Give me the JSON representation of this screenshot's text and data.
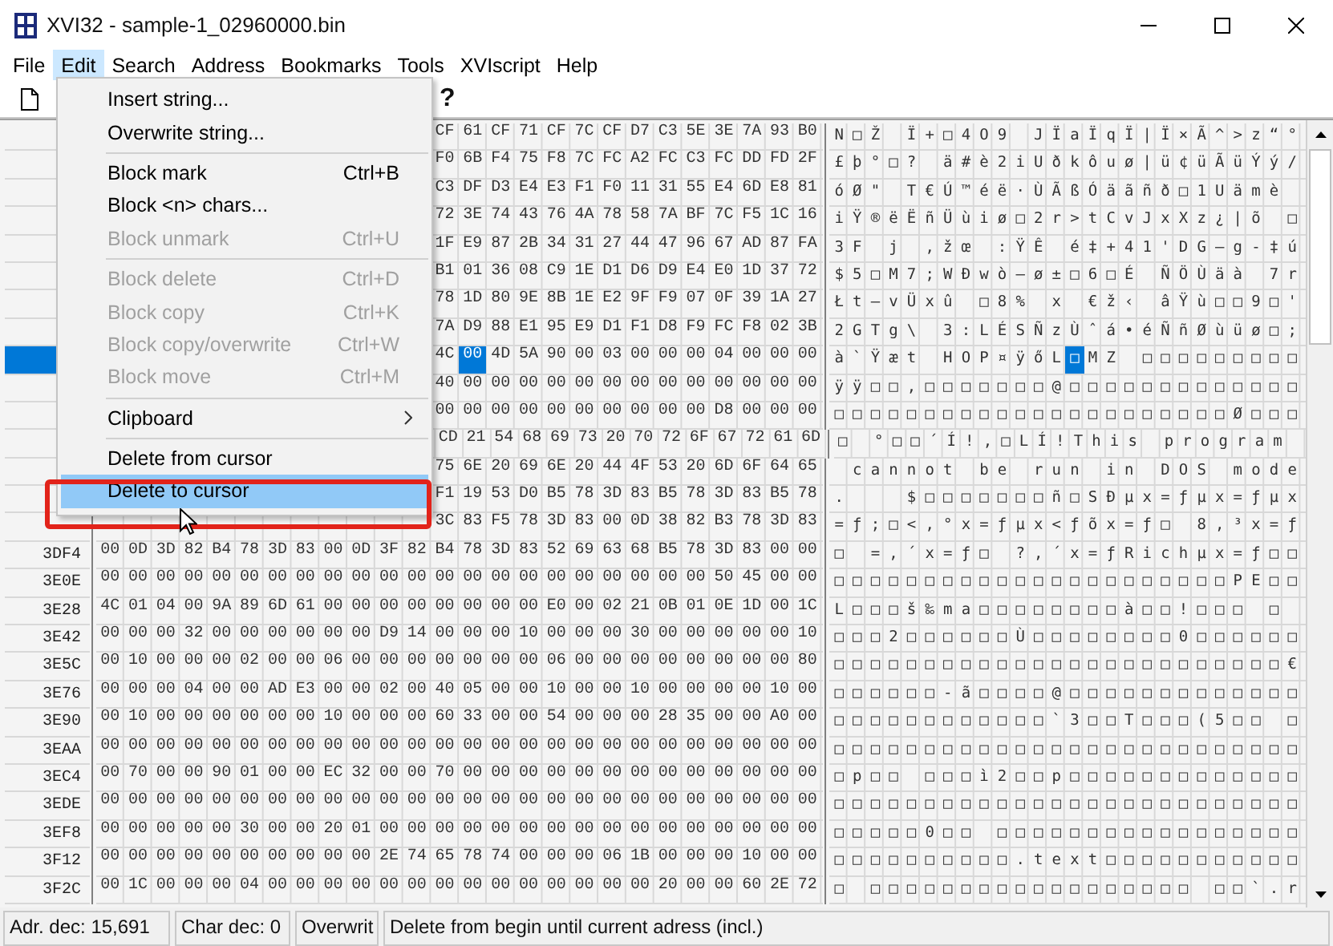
{
  "window": {
    "title": "XVI32 - sample-1_02960000.bin"
  },
  "menu_bar": [
    {
      "label": "File",
      "selected": false
    },
    {
      "label": "Edit",
      "selected": true
    },
    {
      "label": "Search",
      "selected": false
    },
    {
      "label": "Address",
      "selected": false
    },
    {
      "label": "Bookmarks",
      "selected": false
    },
    {
      "label": "Tools",
      "selected": false
    },
    {
      "label": "XVIscript",
      "selected": false
    },
    {
      "label": "Help",
      "selected": false
    }
  ],
  "toolbar": {
    "text": "?"
  },
  "edit_menu": {
    "items": [
      {
        "kind": "item",
        "label": "Insert string...",
        "disabled": false,
        "selected": false
      },
      {
        "kind": "item",
        "label": "Overwrite string...",
        "disabled": false,
        "selected": false
      },
      {
        "kind": "separator"
      },
      {
        "kind": "item",
        "label": "Block mark",
        "shortcut": "Ctrl+B",
        "disabled": false,
        "selected": false
      },
      {
        "kind": "item",
        "label": "Block <n> chars...",
        "disabled": false,
        "selected": false
      },
      {
        "kind": "item",
        "label": "Block unmark",
        "shortcut": "Ctrl+U",
        "disabled": true,
        "selected": false
      },
      {
        "kind": "separator"
      },
      {
        "kind": "item",
        "label": "Block delete",
        "shortcut": "Ctrl+D",
        "disabled": true,
        "selected": false
      },
      {
        "kind": "item",
        "label": "Block copy",
        "shortcut": "Ctrl+K",
        "disabled": true,
        "selected": false
      },
      {
        "kind": "item",
        "label": "Block copy/overwrite",
        "shortcut": "Ctrl+W",
        "disabled": true,
        "selected": false
      },
      {
        "kind": "item",
        "label": "Block move",
        "shortcut": "Ctrl+M",
        "disabled": true,
        "selected": false
      },
      {
        "kind": "separator"
      },
      {
        "kind": "submenu",
        "label": "Clipboard",
        "disabled": false,
        "selected": false
      },
      {
        "kind": "separator"
      },
      {
        "kind": "item",
        "label": "Delete from cursor",
        "disabled": false,
        "selected": false
      },
      {
        "kind": "item",
        "label": "Delete to cursor",
        "disabled": false,
        "selected": true
      }
    ]
  },
  "grid": {
    "rows": [
      {
        "selected": false,
        "hex": [
          "CF",
          "61",
          "CF",
          "71",
          "CF",
          "7C",
          "CF",
          "D7",
          "C3",
          "5E",
          "3E",
          "7A",
          "93",
          "B0"
        ],
        "chars": "N□Ž Ï+□4O9 JÏaÏqÏ|Ï×Ã^>z“°"
      },
      {
        "selected": false,
        "hex": [
          "F0",
          "6B",
          "F4",
          "75",
          "F8",
          "7C",
          "FC",
          "A2",
          "FC",
          "C3",
          "FC",
          "DD",
          "FD",
          "2F"
        ],
        "chars": "£þ°□? ä#è2iUðkôuø|ü¢üÃüÝý/"
      },
      {
        "selected": false,
        "hex": [
          "C3",
          "DF",
          "D3",
          "E4",
          "E3",
          "F1",
          "F0",
          "11",
          "31",
          "55",
          "E4",
          "6D",
          "E8",
          "81"
        ],
        "chars": "óØ\" T€Ú™éë·ÙÃßÓäãñð□1Uämè "
      },
      {
        "selected": false,
        "hex": [
          "72",
          "3E",
          "74",
          "43",
          "76",
          "4A",
          "78",
          "58",
          "7A",
          "BF",
          "7C",
          "F5",
          "1C",
          "16"
        ],
        "chars": "iŸ®ëËñÜùiø□2r>tCvJxXz¿|õ □"
      },
      {
        "selected": false,
        "hex": [
          "1F",
          "E9",
          "87",
          "2B",
          "34",
          "31",
          "27",
          "44",
          "47",
          "96",
          "67",
          "AD",
          "87",
          "FA"
        ],
        "chars": "3F j ,žœ :ŸÊ é‡+41'DG–g-‡ú"
      },
      {
        "selected": false,
        "hex": [
          "B1",
          "01",
          "36",
          "08",
          "C9",
          "1E",
          "D1",
          "D6",
          "D9",
          "E4",
          "E0",
          "1D",
          "37",
          "72"
        ],
        "chars": "$5□M7;WÐwò—ø±□6□É ÑÖÙäà 7r"
      },
      {
        "selected": false,
        "hex": [
          "78",
          "1D",
          "80",
          "9E",
          "8B",
          "1E",
          "E2",
          "9F",
          "F9",
          "07",
          "0F",
          "39",
          "1A",
          "27"
        ],
        "chars": "Łt–vÜxû □8% x €ž‹ âŸù□□9□'"
      },
      {
        "selected": false,
        "hex": [
          "7A",
          "D9",
          "88",
          "E1",
          "95",
          "E9",
          "D1",
          "F1",
          "D8",
          "F9",
          "FC",
          "F8",
          "02",
          "3B"
        ],
        "chars": "2GTg\\ 3:LÉSÑzÙˆá•éÑñØùüø□;"
      },
      {
        "selected": true,
        "hex": [
          "4C"
        ],
        "chars": "à`Ÿæt HOP¤ÿőL",
        "cursor": {
          "hex": "00",
          "char": "□",
          "hex_after": [
            "4D",
            "5A",
            "90",
            "00",
            "03",
            "00",
            "00",
            "00",
            "04",
            "00",
            "00",
            "00"
          ],
          "chars_after": "MZ □□□□□□□□□"
        }
      },
      {
        "selected": false,
        "hex": [
          "40",
          "00",
          "00",
          "00",
          "00",
          "00",
          "00",
          "00",
          "00",
          "00",
          "00",
          "00",
          "00",
          "00"
        ],
        "chars": "ÿÿ□□,□□□□□□□@□□□□□□□□□□□□□"
      },
      {
        "selected": false,
        "hex": [
          "00",
          "00",
          "00",
          "00",
          "00",
          "00",
          "00",
          "00",
          "00",
          "00",
          "D8",
          "00",
          "00",
          "00"
        ],
        "chars": "□□□□□□□□□□□□□□□□□□□□□□Ø□□□"
      },
      {
        "selected": false,
        "hex": [
          "CD",
          "21",
          "54",
          "68",
          "69",
          "73",
          "20",
          "70",
          "72",
          "6F",
          "67",
          "72",
          "61",
          "6D"
        ],
        "chars": "□ °□□´Í!,□LÍ!This program"
      },
      {
        "selected": false,
        "hex": [
          "75",
          "6E",
          "20",
          "69",
          "6E",
          "20",
          "44",
          "4F",
          "53",
          "20",
          "6D",
          "6F",
          "64",
          "65"
        ],
        "chars": " cannot be run in DOS mode"
      },
      {
        "selected": false,
        "hex": [
          "F1",
          "19",
          "53",
          "D0",
          "B5",
          "78",
          "3D",
          "83",
          "B5",
          "78",
          "3D",
          "83",
          "B5",
          "78"
        ],
        "chars": ".   $□□□□□□□ñ□SÐµx=ƒµx=ƒµx"
      },
      {
        "selected": false,
        "hex": [
          "3C",
          "83",
          "F5",
          "78",
          "3D",
          "83",
          "00",
          "0D",
          "38",
          "82",
          "B3",
          "78",
          "3D",
          "83"
        ],
        "chars": "=ƒ;□<,°x=ƒµx<ƒõx=ƒ□ 8‚³x=ƒ"
      },
      {
        "address": "3DF4",
        "selected": false,
        "hex": [
          "00",
          "0D",
          "3D",
          "82",
          "B4",
          "78",
          "3D",
          "83",
          "00",
          "0D",
          "3F",
          "82",
          "B4",
          "78",
          "3D",
          "83",
          "52",
          "69",
          "63",
          "68",
          "B5",
          "78",
          "3D",
          "83",
          "00",
          "00"
        ],
        "chars": "□ =‚´x=ƒ□ ?‚´x=ƒRichµx=ƒ□□"
      },
      {
        "address": "3E0E",
        "selected": false,
        "hex": [
          "00",
          "00",
          "00",
          "00",
          "00",
          "00",
          "00",
          "00",
          "00",
          "00",
          "00",
          "00",
          "00",
          "00",
          "00",
          "00",
          "00",
          "00",
          "00",
          "00",
          "00",
          "00",
          "50",
          "45",
          "00",
          "00"
        ],
        "chars": "□□□□□□□□□□□□□□□□□□□□□□PE□□"
      },
      {
        "address": "3E28",
        "selected": false,
        "hex": [
          "4C",
          "01",
          "04",
          "00",
          "9A",
          "89",
          "6D",
          "61",
          "00",
          "00",
          "00",
          "00",
          "00",
          "00",
          "00",
          "00",
          "E0",
          "00",
          "02",
          "21",
          "0B",
          "01",
          "0E",
          "1D",
          "00",
          "1C"
        ],
        "chars": "L□□□š‰ma□□□□□□□□à□□!□□□ □ "
      },
      {
        "address": "3E42",
        "selected": false,
        "hex": [
          "00",
          "00",
          "00",
          "32",
          "00",
          "00",
          "00",
          "00",
          "00",
          "00",
          "D9",
          "14",
          "00",
          "00",
          "00",
          "10",
          "00",
          "00",
          "00",
          "30",
          "00",
          "00",
          "00",
          "00",
          "00",
          "10"
        ],
        "chars": "□□□2□□□□□□Ù□□□□□□□□0□□□□□□"
      },
      {
        "address": "3E5C",
        "selected": false,
        "hex": [
          "00",
          "10",
          "00",
          "00",
          "00",
          "02",
          "00",
          "00",
          "06",
          "00",
          "00",
          "00",
          "00",
          "00",
          "00",
          "00",
          "06",
          "00",
          "00",
          "00",
          "00",
          "00",
          "00",
          "00",
          "00",
          "80"
        ],
        "chars": "□□□□□□□□□□□□□□□□□□□□□□□□□€"
      },
      {
        "address": "3E76",
        "selected": false,
        "hex": [
          "00",
          "00",
          "00",
          "04",
          "00",
          "00",
          "AD",
          "E3",
          "00",
          "00",
          "02",
          "00",
          "40",
          "05",
          "00",
          "00",
          "10",
          "00",
          "00",
          "10",
          "00",
          "00",
          "00",
          "00",
          "10",
          "00"
        ],
        "chars": "□□□□□□-ã□□□□@□□□□□□□□□□□□□"
      },
      {
        "address": "3E90",
        "selected": false,
        "hex": [
          "00",
          "10",
          "00",
          "00",
          "00",
          "00",
          "00",
          "00",
          "10",
          "00",
          "00",
          "00",
          "60",
          "33",
          "00",
          "00",
          "54",
          "00",
          "00",
          "00",
          "28",
          "35",
          "00",
          "00",
          "A0",
          "00"
        ],
        "chars": "□□□□□□□□□□□□`3□□T□□□(5□□ □"
      },
      {
        "address": "3EAA",
        "selected": false,
        "hex": [
          "00",
          "00",
          "00",
          "00",
          "00",
          "00",
          "00",
          "00",
          "00",
          "00",
          "00",
          "00",
          "00",
          "00",
          "00",
          "00",
          "00",
          "00",
          "00",
          "00",
          "00",
          "00",
          "00",
          "00",
          "00",
          "00"
        ],
        "chars": "□□□□□□□□□□□□□□□□□□□□□□□□□□"
      },
      {
        "address": "3EC4",
        "selected": false,
        "hex": [
          "00",
          "70",
          "00",
          "00",
          "90",
          "01",
          "00",
          "00",
          "EC",
          "32",
          "00",
          "00",
          "70",
          "00",
          "00",
          "00",
          "00",
          "00",
          "00",
          "00",
          "00",
          "00",
          "00",
          "00",
          "00",
          "00"
        ],
        "chars": "□p□□ □□□ì2□□p□□□□□□□□□□□□□"
      },
      {
        "address": "3EDE",
        "selected": false,
        "hex": [
          "00",
          "00",
          "00",
          "00",
          "00",
          "00",
          "00",
          "00",
          "00",
          "00",
          "00",
          "00",
          "00",
          "00",
          "00",
          "00",
          "00",
          "00",
          "00",
          "00",
          "00",
          "00",
          "00",
          "00",
          "00",
          "00"
        ],
        "chars": "□□□□□□□□□□□□□□□□□□□□□□□□□□"
      },
      {
        "address": "3EF8",
        "selected": false,
        "hex": [
          "00",
          "00",
          "00",
          "00",
          "00",
          "30",
          "00",
          "00",
          "20",
          "01",
          "00",
          "00",
          "00",
          "00",
          "00",
          "00",
          "00",
          "00",
          "00",
          "00",
          "00",
          "00",
          "00",
          "00",
          "00",
          "00"
        ],
        "chars": "□□□□□0□□ □□□□□□□□□□□□□□□□□"
      },
      {
        "address": "3F12",
        "selected": false,
        "hex": [
          "00",
          "00",
          "00",
          "00",
          "00",
          "00",
          "00",
          "00",
          "00",
          "00",
          "2E",
          "74",
          "65",
          "78",
          "74",
          "00",
          "00",
          "00",
          "06",
          "1B",
          "00",
          "00",
          "00",
          "10",
          "00",
          "00"
        ],
        "chars": "□□□□□□□□□□.text□□□□□□□□□□□"
      },
      {
        "address": "3F2C",
        "selected": false,
        "hex": [
          "00",
          "1C",
          "00",
          "00",
          "00",
          "04",
          "00",
          "00",
          "00",
          "00",
          "00",
          "00",
          "00",
          "00",
          "00",
          "00",
          "00",
          "00",
          "00",
          "00",
          "20",
          "00",
          "00",
          "60",
          "2E",
          "72"
        ],
        "chars": "□ □□□□□□□□□□□□□□□□□□ □□`.r"
      }
    ]
  },
  "status_bar": [
    "Adr. dec: 15,691",
    "Char dec: 0",
    "Overwrit",
    "Delete from begin until current adress (incl.)"
  ]
}
